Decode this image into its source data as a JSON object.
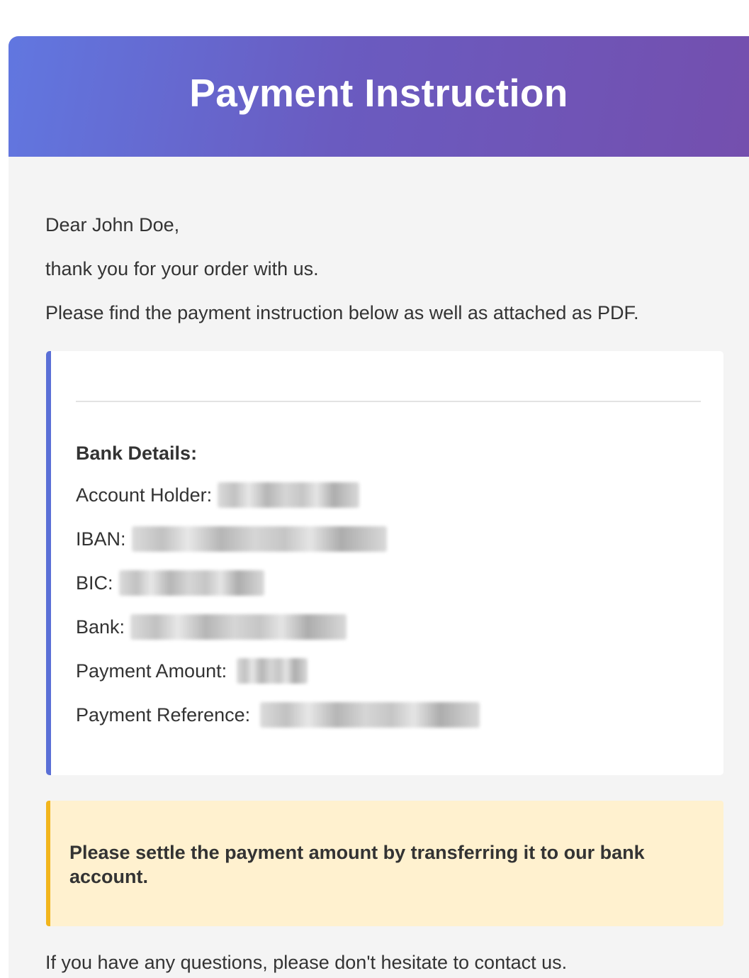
{
  "header": {
    "title": "Payment Instruction"
  },
  "body": {
    "greeting": "Dear John Doe,",
    "thanks": "thank you for your order with us.",
    "intro": "Please find the payment instruction below as well as attached as PDF.",
    "closing": "If you have any questions, please don't hesitate to contact us."
  },
  "bank_details": {
    "heading": "Bank Details:",
    "fields": [
      {
        "label": "Account Holder:",
        "value_redacted": true
      },
      {
        "label": "IBAN:",
        "value_redacted": true
      },
      {
        "label": "BIC:",
        "value_redacted": true
      },
      {
        "label": "Bank:",
        "value_redacted": true
      },
      {
        "label": "Payment Amount:",
        "value_redacted": true
      },
      {
        "label": "Payment Reference:",
        "value_redacted": true
      }
    ]
  },
  "notice": {
    "text": "Please settle the payment amount by transferring it to our bank account."
  },
  "colors": {
    "header_gradient_start": "#6177e0",
    "header_gradient_end": "#744fae",
    "card_accent": "#5a6fd6",
    "notice_background": "#fff1cf",
    "notice_accent": "#f2b51c",
    "text": "#333333"
  }
}
